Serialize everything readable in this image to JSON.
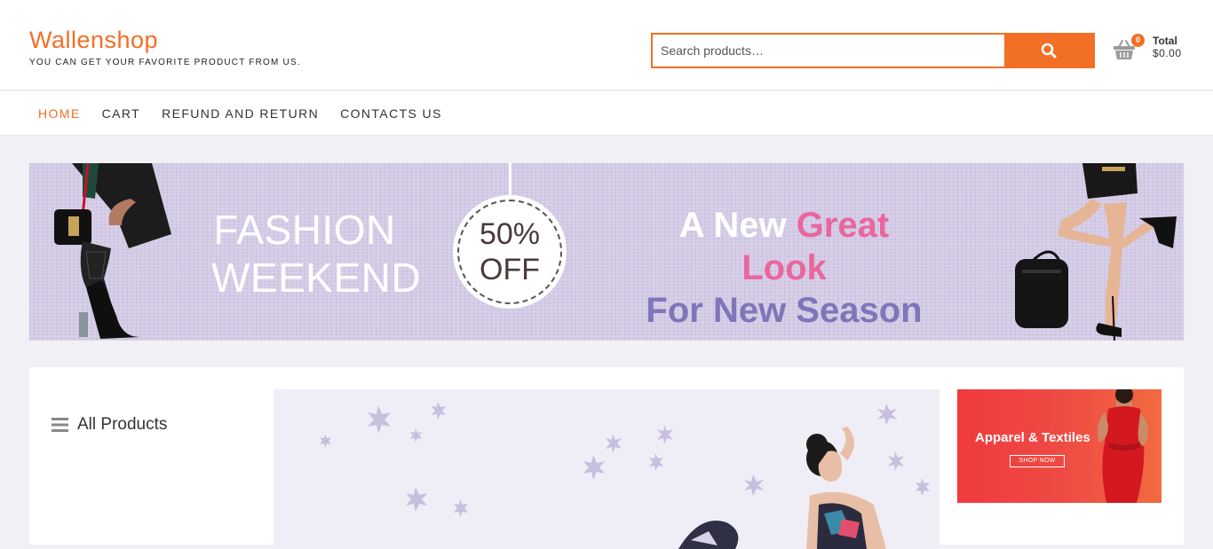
{
  "brand": {
    "name": "Wallenshop",
    "tagline": "YOU CAN GET YOUR FAVORITE PRODUCT FROM US."
  },
  "search": {
    "placeholder": "Search products…",
    "button_icon": "search-icon"
  },
  "cart": {
    "icon": "basket-icon",
    "count": "0",
    "total_label": "Total",
    "total_value": "$0.00"
  },
  "nav": {
    "items": [
      {
        "label": "HOME",
        "active": true
      },
      {
        "label": "CART",
        "active": false
      },
      {
        "label": "REFUND AND RETURN",
        "active": false
      },
      {
        "label": "CONTACTS US",
        "active": false
      }
    ]
  },
  "banner": {
    "line1": "FASHION",
    "line2": "WEEKEND",
    "discount_value": "50%",
    "discount_label": "OFF",
    "headline_a": "A New",
    "headline_b": "Great Look",
    "headline_c": "For New Season"
  },
  "categories": {
    "icon": "menu-icon",
    "label": "All Products"
  },
  "promo": {
    "title": "Apparel & Textiles",
    "button": "SHOP NOW"
  },
  "colors": {
    "accent": "#f26f26",
    "banner_bg": "#d4cbe6",
    "pink": "#e9679c",
    "purple": "#7e76b7",
    "promo_red": "#f13a3e"
  }
}
